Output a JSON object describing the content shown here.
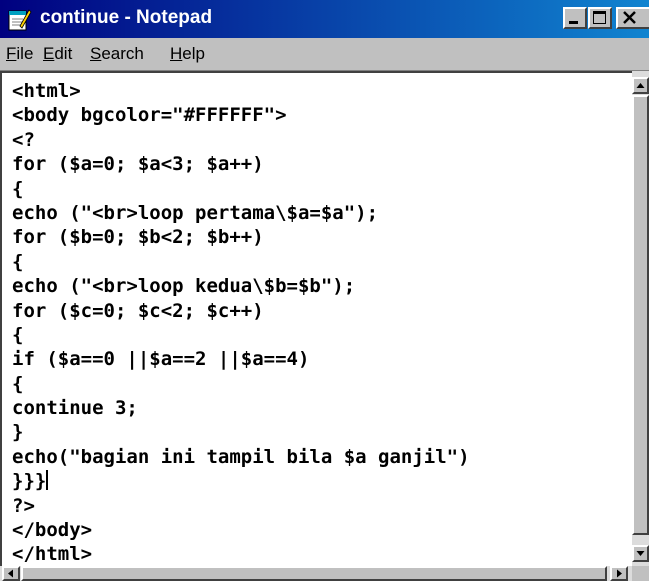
{
  "window": {
    "title": "continue - Notepad",
    "icon": "notepad-icon",
    "title_color": "#000080",
    "controls": [
      "minimize-icon",
      "maximize-icon",
      "close-icon"
    ]
  },
  "menu": {
    "items": [
      {
        "label": "File",
        "mnemonic": "F",
        "rest": "ile"
      },
      {
        "label": "Edit",
        "mnemonic": "E",
        "rest": "dit"
      },
      {
        "label": "Search",
        "mnemonic": "S",
        "rest": "earch"
      },
      {
        "label": "Help",
        "mnemonic": "H",
        "rest": "elp"
      }
    ]
  },
  "editor": {
    "background": "#FFFFFF",
    "lines": [
      "<html>",
      "<body bgcolor=\"#FFFFFF\">",
      "<?",
      "for ($a=0; $a<3; $a++)",
      "{",
      "echo (\"<br>loop pertama\\$a=$a\");",
      "for ($b=0; $b<2; $b++)",
      "{",
      "echo (\"<br>loop kedua\\$b=$b\");",
      "for ($c=0; $c<2; $c++)",
      "{",
      "if ($a==0 ||$a==2 ||$a==4)",
      "{",
      "continue 3;",
      "}",
      "echo(\"bagian ini tampil bila $a ganjil\")",
      "}}}",
      "?>",
      "</body>",
      "</html>"
    ],
    "caret_line": 16
  }
}
